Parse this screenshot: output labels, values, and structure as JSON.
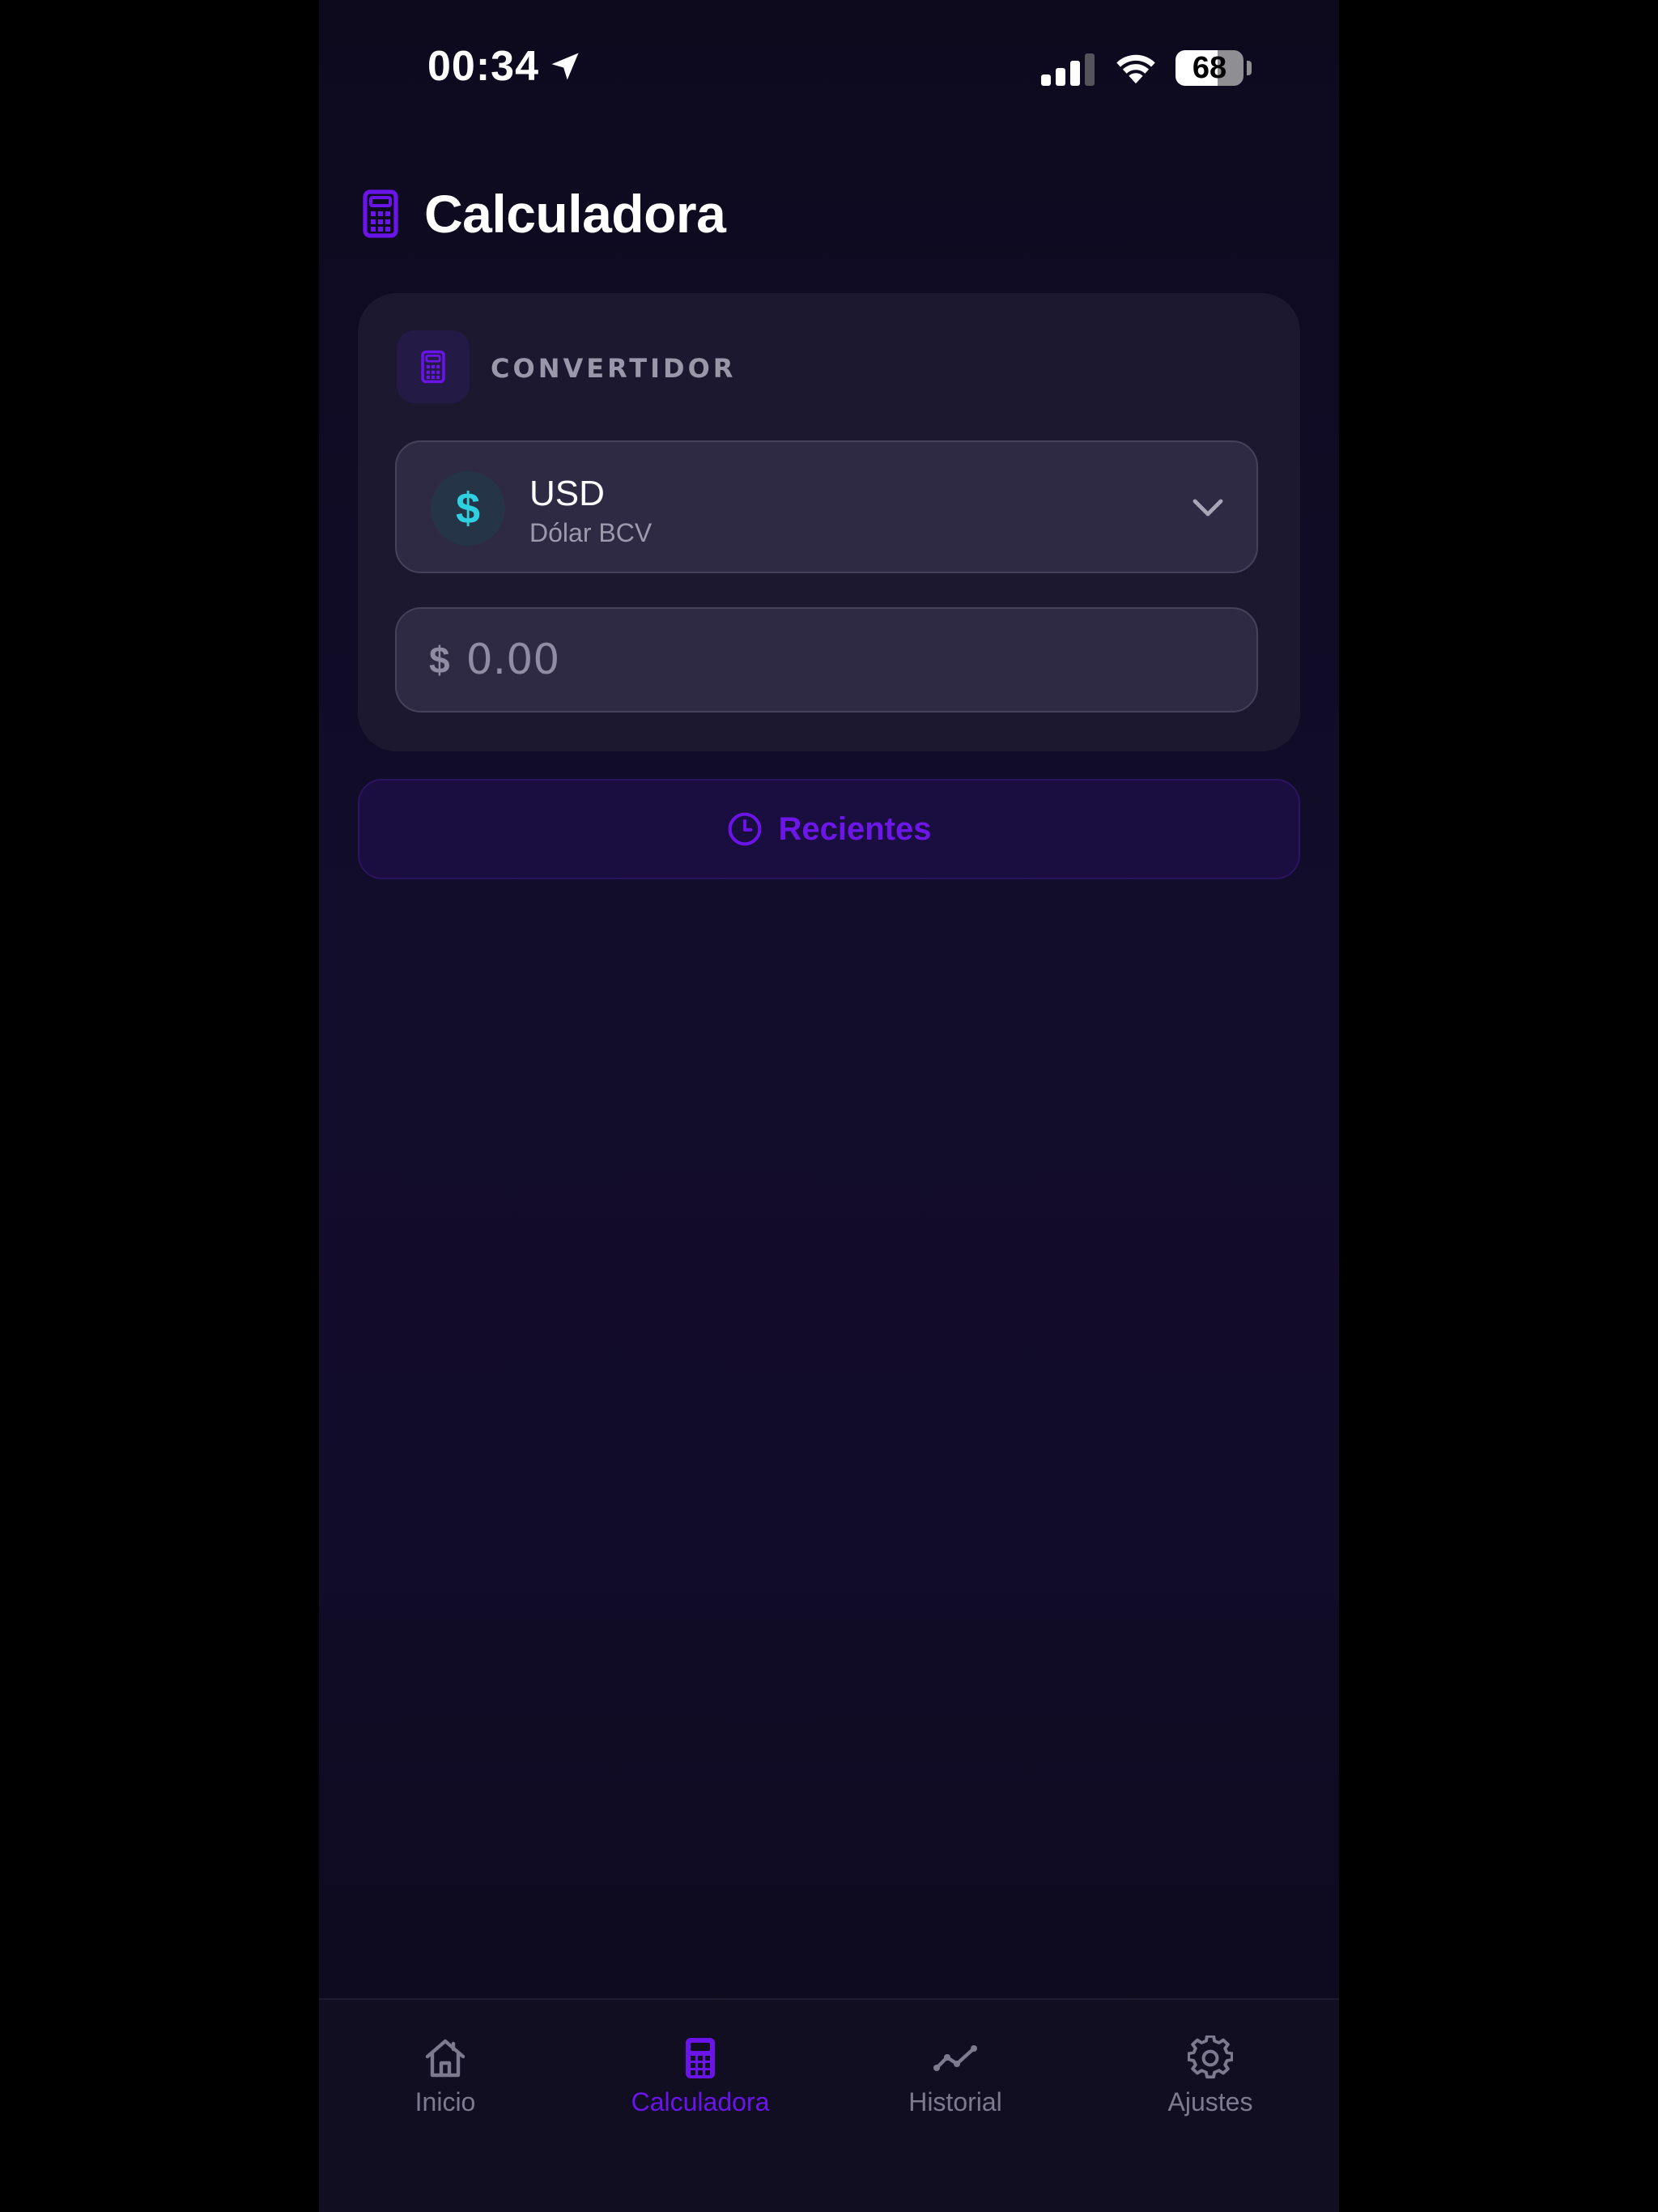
{
  "status_bar": {
    "time": "00:34",
    "battery": "68"
  },
  "header": {
    "title": "Calculadora"
  },
  "converter": {
    "label": "CONVERTIDOR",
    "currency": {
      "symbol": "$",
      "code": "USD",
      "name": "Dólar BCV"
    },
    "amount": {
      "prefix": "$",
      "value": "",
      "placeholder": "0.00"
    }
  },
  "recent_button": {
    "label": "Recientes"
  },
  "tabbar": {
    "items": [
      {
        "label": "Inicio",
        "icon": "home-icon",
        "active": false
      },
      {
        "label": "Calculadora",
        "icon": "calculator-icon",
        "active": true
      },
      {
        "label": "Historial",
        "icon": "chart-line-icon",
        "active": false
      },
      {
        "label": "Ajustes",
        "icon": "gear-icon",
        "active": false
      }
    ]
  },
  "colors": {
    "accent": "#6a14ea",
    "coin": "#2fd1e0",
    "background": "#120d2b",
    "card": "#1b1830"
  }
}
